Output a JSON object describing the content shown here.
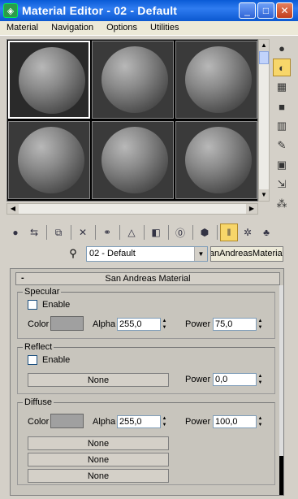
{
  "window": {
    "title": "Material Editor - 02 - Default",
    "minimize": "_",
    "maximize": "□",
    "close": "✕"
  },
  "menu": [
    "Material",
    "Navigation",
    "Options",
    "Utilities"
  ],
  "slots": [
    "01",
    "02",
    "03",
    "04",
    "05",
    "06"
  ],
  "active_slot": 0,
  "toolbar_row": {
    "material_name": "02 - Default",
    "type_button": "anAndreasMaterial"
  },
  "rollout": {
    "title": "San Andreas Material",
    "collapse_symbol": "-",
    "specular": {
      "label": "Specular",
      "enable_label": "Enable",
      "color_label": "Color",
      "alpha_label": "Alpha",
      "alpha_value": "255,0",
      "power_label": "Power",
      "power_value": "75,0",
      "color": "#a0a0a0"
    },
    "reflect": {
      "label": "Reflect",
      "enable_label": "Enable",
      "map_button": "None",
      "power_label": "Power",
      "power_value": "0,0"
    },
    "diffuse": {
      "label": "Diffuse",
      "color_label": "Color",
      "alpha_label": "Alpha",
      "alpha_value": "255,0",
      "power_label": "Power",
      "power_value": "100,0",
      "color": "#a0a0a0",
      "map_buttons": [
        "None",
        "None",
        "None"
      ]
    }
  },
  "icons": {
    "side": [
      "sample-type-icon",
      "backlight-icon",
      "background-icon",
      "uv-tiling-icon",
      "video-color-check-icon",
      "make-preview-icon",
      "options-icon",
      "select-by-material-icon",
      "material-navigator-icon"
    ],
    "bottom": [
      "get-material-icon",
      "put-to-scene-icon",
      "assign-to-selection-icon",
      "reset-map-icon",
      "make-unique-icon",
      "put-to-library-icon",
      "material-id-icon",
      "show-map-icon",
      "show-end-result-icon",
      "go-to-parent-icon",
      "go-forward-icon"
    ]
  }
}
